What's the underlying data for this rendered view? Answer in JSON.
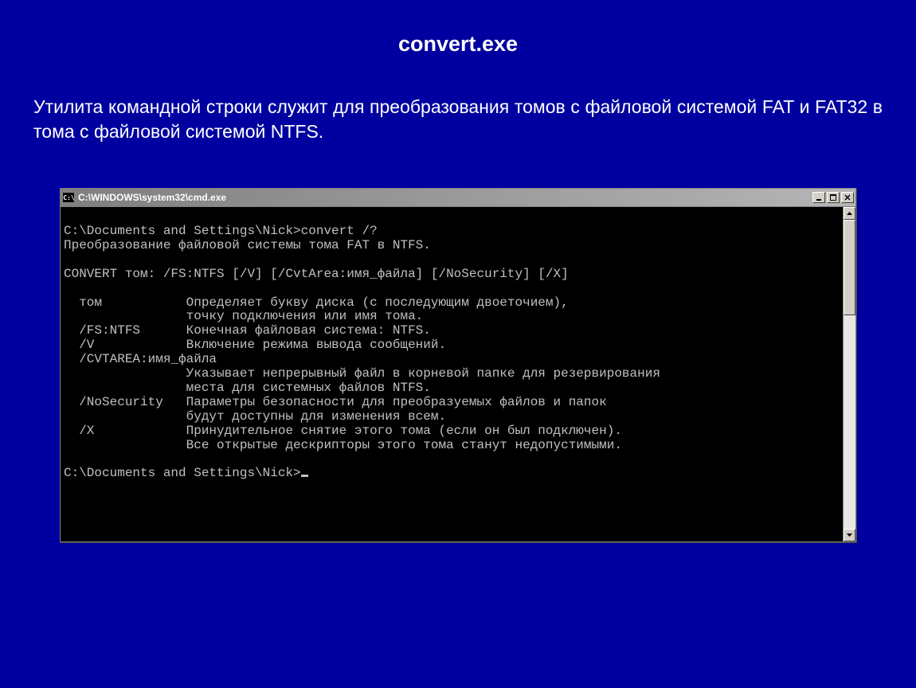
{
  "slide": {
    "title": "convert.exe",
    "description": "Утилита командной строки служит для преобразования томов с файловой системой FAT и FAT32 в тома с файловой системой NTFS."
  },
  "cmd": {
    "icon_text": "C:\\",
    "title": "C:\\WINDOWS\\system32\\cmd.exe",
    "lines": [
      "",
      "C:\\Documents and Settings\\Nick>convert /?",
      "Преобразование файловой системы тома FAT в NTFS.",
      "",
      "CONVERT том: /FS:NTFS [/V] [/CvtArea:имя_файла] [/NoSecurity] [/X]",
      "",
      "  том           Определяет букву диска (с последующим двоеточием),",
      "                точку подключения или имя тома.",
      "  /FS:NTFS      Конечная файловая система: NTFS.",
      "  /V            Включение режима вывода сообщений.",
      "  /CVTAREA:имя_файла",
      "                Указывает непрерывный файл в корневой папке для резервирования",
      "                места для системных файлов NTFS.",
      "  /NoSecurity   Параметры безопасности для преобразуемых файлов и папок",
      "                будут доступны для изменения всем.",
      "  /X            Принудительное снятие этого тома (если он был подключен).",
      "                Все открытые дескрипторы этого тома станут недопустимыми.",
      "",
      "C:\\Documents and Settings\\Nick>"
    ]
  }
}
